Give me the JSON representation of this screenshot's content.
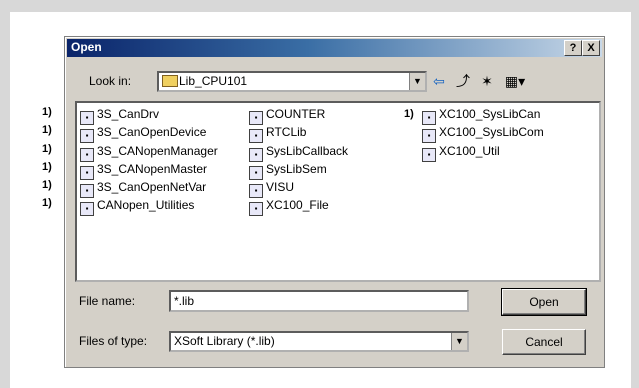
{
  "dialog": {
    "title": "Open",
    "help_label": "?",
    "close_label": "X",
    "look_in_label": "Look in:",
    "look_in_value": "Lib_CPU101",
    "file_name_label": "File name:",
    "file_name_value": "*.lib",
    "files_of_type_label": "Files of type:",
    "files_of_type_value": "XSoft Library (*.lib)",
    "open_button": "Open",
    "cancel_button": "Cancel"
  },
  "files": {
    "col1": [
      "3S_CanDrv",
      "3S_CanOpenDevice",
      "3S_CANopenManager",
      "3S_CANopenMaster",
      "3S_CanOpenNetVar",
      "CANopen_Utilities"
    ],
    "col2": [
      "COUNTER",
      "RTCLib",
      "SysLibCallback",
      "SysLibSem",
      "VISU",
      "XC100_File"
    ],
    "col3": [
      "XC100_SysLibCan",
      "XC100_SysLibCom",
      "XC100_Util"
    ]
  },
  "markers": {
    "label": "1)"
  },
  "icons": {
    "folder": "folder-icon",
    "back": "back-arrow-icon",
    "up": "up-folder-icon",
    "new_folder": "new-folder-icon",
    "view": "view-menu-icon",
    "file": "library-file-icon"
  }
}
